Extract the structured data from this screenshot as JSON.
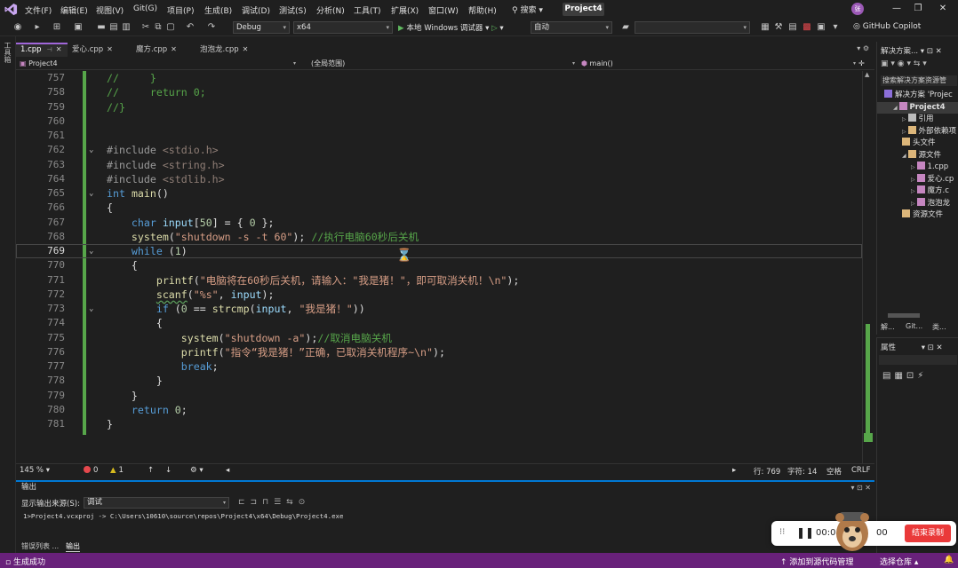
{
  "menu": {
    "items": [
      "文件(F)",
      "编辑(E)",
      "视图(V)",
      "Git(G)",
      "项目(P)",
      "生成(B)",
      "调试(D)",
      "测试(S)",
      "分析(N)",
      "工具(T)",
      "扩展(X)",
      "窗口(W)",
      "帮助(H)"
    ],
    "search": "搜索",
    "project": "Project4",
    "avatar": "张"
  },
  "toolbar": {
    "config": "Debug",
    "platform": "x64",
    "run_label": "本地 Windows 调试器",
    "auto": "自动",
    "copilot": "GitHub Copilot"
  },
  "left_strip": {
    "toolbox": "工具箱"
  },
  "editor_tabs": [
    {
      "label": "1.cpp",
      "active": true
    },
    {
      "label": "爱心.cpp",
      "active": false
    },
    {
      "label": "魔方.cpp",
      "active": false
    },
    {
      "label": "泡泡龙.cpp",
      "active": false
    }
  ],
  "navbar": {
    "project": "Project4",
    "scope": "(全局范围)",
    "function": "main()"
  },
  "code": {
    "current_line": 769,
    "lines": [
      {
        "n": 757,
        "fold": "",
        "html": "<span class='cm'>//     }</span>"
      },
      {
        "n": 758,
        "fold": "",
        "html": "<span class='cm'>//     return 0;</span>"
      },
      {
        "n": 759,
        "fold": "",
        "html": "<span class='cm'>//}</span>"
      },
      {
        "n": 760,
        "fold": "",
        "html": ""
      },
      {
        "n": 761,
        "fold": "",
        "html": ""
      },
      {
        "n": 762,
        "fold": "⌄",
        "html": "<span class='pp'>#include</span> <span class='inc'>&lt;stdio.h&gt;</span>"
      },
      {
        "n": 763,
        "fold": "",
        "html": "<span class='pp'>#include</span> <span class='inc'>&lt;string.h&gt;</span>"
      },
      {
        "n": 764,
        "fold": "",
        "html": "<span class='pp'>#include</span> <span class='inc'>&lt;stdlib.h&gt;</span>"
      },
      {
        "n": 765,
        "fold": "⌄",
        "html": "<span class='tp'>int</span> <span class='fn'>main</span>()"
      },
      {
        "n": 766,
        "fold": "",
        "html": "{"
      },
      {
        "n": 767,
        "fold": "",
        "html": "    <span class='tp'>char</span> <span class='var'>input</span>[<span class='num-lit'>50</span>] = { <span class='num-lit'>0</span> };"
      },
      {
        "n": 768,
        "fold": "",
        "html": "    <span class='fn'>system</span>(<span class='str'>\"shutdown -s -t 60\"</span>); <span class='cm'>//执行电脑60秒后关机</span>"
      },
      {
        "n": 769,
        "fold": "⌄",
        "html": "    <span class='kw'>while</span> (<span class='num-lit'>1</span>)"
      },
      {
        "n": 770,
        "fold": "",
        "html": "    {"
      },
      {
        "n": 771,
        "fold": "",
        "html": "        <span class='fn'>printf</span>(<span class='str'>\"电脑将在60秒后关机，请输入：\"我是猪！\"，即可取消关机！\\n\"</span>);"
      },
      {
        "n": 772,
        "fold": "",
        "html": "        <span class='fn squiggle'>scanf</span>(<span class='str'>\"%s\"</span>, <span class='var'>input</span>);"
      },
      {
        "n": 773,
        "fold": "⌄",
        "html": "        <span class='kw'>if</span> (<span class='num-lit'>0</span> == <span class='fn'>strcmp</span>(<span class='var'>input</span>, <span class='str'>\"我是猪！\"</span>))"
      },
      {
        "n": 774,
        "fold": "",
        "html": "        {"
      },
      {
        "n": 775,
        "fold": "",
        "html": "            <span class='fn'>system</span>(<span class='str'>\"shutdown -a\"</span>);<span class='cm'>//取消电脑关机</span>"
      },
      {
        "n": 776,
        "fold": "",
        "html": "            <span class='fn'>printf</span>(<span class='str'>\"指令“我是猪！”正确，已取消关机程序~\\n\"</span>);"
      },
      {
        "n": 777,
        "fold": "",
        "html": "            <span class='kw'>break</span>;"
      },
      {
        "n": 778,
        "fold": "",
        "html": "        }"
      },
      {
        "n": 779,
        "fold": "",
        "html": "    }"
      },
      {
        "n": 780,
        "fold": "",
        "html": "    <span class='kw'>return</span> <span class='num-lit'>0</span>;"
      },
      {
        "n": 781,
        "fold": "",
        "html": "}"
      }
    ]
  },
  "editor_status": {
    "zoom": "145 %",
    "errors": "0",
    "warnings": "1",
    "line": "行: 769",
    "char": "字符: 14",
    "spaces": "空格",
    "eol": "CRLF"
  },
  "output": {
    "title": "输出",
    "source_label": "显示输出来源(S):",
    "source_value": "调试",
    "text": "1>Project4.vcxproj -> C:\\Users\\10610\\source\\repos\\Project4\\x64\\Debug\\Project4.exe",
    "tabs": [
      "错误列表 ...",
      "输出"
    ]
  },
  "solution": {
    "title": "解决方案...",
    "search": "搜索解决方案资源管",
    "items": [
      {
        "label": "解决方案 'Projec",
        "indent": 0,
        "sel": false,
        "icon": "solution-icon"
      },
      {
        "label": "Project4",
        "indent": 1,
        "sel": true,
        "icon": "project-icon"
      },
      {
        "label": "引用",
        "indent": 2,
        "sel": false,
        "icon": "references-icon"
      },
      {
        "label": "外部依赖项",
        "indent": 2,
        "sel": false,
        "icon": "folder-icon"
      },
      {
        "label": "头文件",
        "indent": 2,
        "sel": false,
        "icon": "folder-icon"
      },
      {
        "label": "源文件",
        "indent": 2,
        "sel": false,
        "icon": "folder-icon"
      },
      {
        "label": "1.cpp",
        "indent": 3,
        "sel": false,
        "icon": "cpp-file-icon"
      },
      {
        "label": "爱心.cp",
        "indent": 3,
        "sel": false,
        "icon": "cpp-file-icon"
      },
      {
        "label": "魔方.c",
        "indent": 3,
        "sel": false,
        "icon": "cpp-file-icon"
      },
      {
        "label": "泡泡龙",
        "indent": 3,
        "sel": false,
        "icon": "cpp-file-icon"
      },
      {
        "label": "资源文件",
        "indent": 2,
        "sel": false,
        "icon": "folder-icon"
      }
    ],
    "tabs": [
      "解...",
      "Git...",
      "类..."
    ]
  },
  "properties": {
    "title": "属性"
  },
  "recorder": {
    "time1": "00:0",
    "time2": "00",
    "stop_label": "结束录制"
  },
  "statusbar": {
    "ready": "生成成功",
    "source_control": "添加到源代码管理",
    "select_repo": "选择仓库"
  },
  "colors": {
    "accent": "#68217a",
    "active_tab": "#a066d9",
    "change_bar": "#57a64a",
    "record": "#ea3a3a"
  }
}
